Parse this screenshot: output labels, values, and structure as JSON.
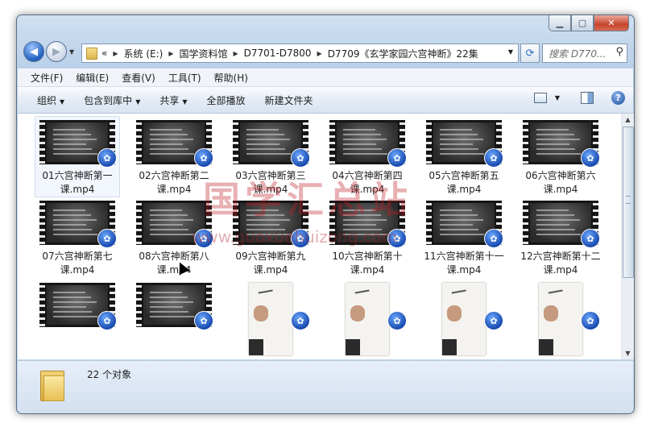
{
  "window": {
    "caption_buttons": [
      "minimize",
      "maximize",
      "close"
    ]
  },
  "address": {
    "prefix": "«",
    "crumbs": [
      "系统 (E:)",
      "国学资料馆",
      "D7701-D7800",
      "D7709《玄学家园六宫神断》22集"
    ]
  },
  "search": {
    "placeholder": "搜索 D770..."
  },
  "menu": [
    "文件(F)",
    "编辑(E)",
    "查看(V)",
    "工具(T)",
    "帮助(H)"
  ],
  "toolbar": {
    "organize": "组织",
    "include_in_library": "包含到库中",
    "share": "共享",
    "play_all": "全部播放",
    "new_folder": "新建文件夹"
  },
  "files": [
    {
      "name": "01六宫神断第一课.mp4",
      "thumb": "film"
    },
    {
      "name": "02六宫神断第二课.mp4",
      "thumb": "film"
    },
    {
      "name": "03六宫神断第三课.mp4",
      "thumb": "film"
    },
    {
      "name": "04六宫神断第四课.mp4",
      "thumb": "film"
    },
    {
      "name": "05六宫神断第五课.mp4",
      "thumb": "film"
    },
    {
      "name": "06六宫神断第六课.mp4",
      "thumb": "film"
    },
    {
      "name": "07六宫神断第七课.mp4",
      "thumb": "film"
    },
    {
      "name": "08六宫神断第八课.mp4",
      "thumb": "film"
    },
    {
      "name": "09六宫神断第九课.mp4",
      "thumb": "film"
    },
    {
      "name": "10六宫神断第十课.mp4",
      "thumb": "film"
    },
    {
      "name": "11六宫神断第十一课.mp4",
      "thumb": "film"
    },
    {
      "name": "12六宫神断第十二课.mp4",
      "thumb": "film"
    },
    {
      "name": "",
      "thumb": "film"
    },
    {
      "name": "",
      "thumb": "film"
    },
    {
      "name": "",
      "thumb": "paper"
    },
    {
      "name": "",
      "thumb": "paper"
    },
    {
      "name": "",
      "thumb": "paper"
    },
    {
      "name": "",
      "thumb": "paper"
    }
  ],
  "status": {
    "count_text": "22 个对象"
  },
  "watermark": {
    "text": "国学汇总站",
    "url": "www.guoxuehuizong.com"
  },
  "colors": {
    "accent": "#1f5fbf",
    "watermark": "#c02028"
  }
}
